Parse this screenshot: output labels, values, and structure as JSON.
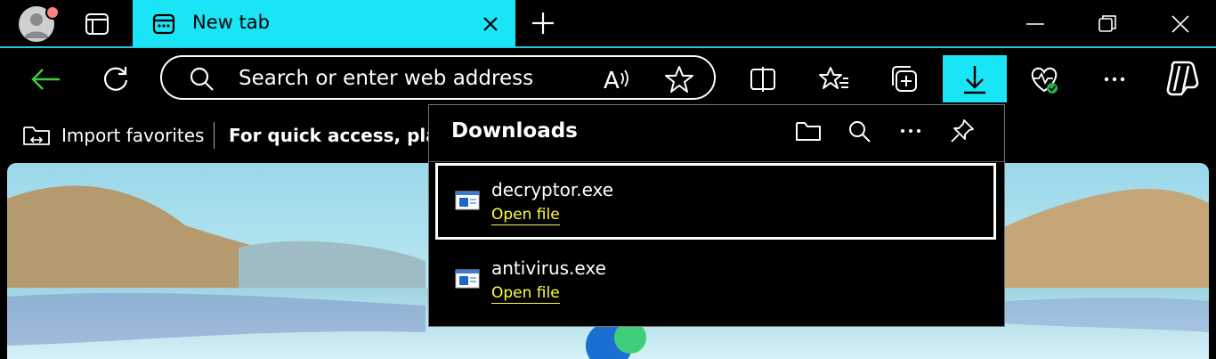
{
  "titlebar": {
    "tab_title": "New tab",
    "profile_icon": "profile-avatar-icon",
    "tab_actions_icon": "tab-actions-icon",
    "new_tab_icon": "plus-icon",
    "window_controls": [
      "minimize-icon",
      "restore-icon",
      "close-icon"
    ]
  },
  "toolbar": {
    "address_placeholder": "Search or enter web address",
    "icons": [
      "back-arrow-icon",
      "refresh-icon",
      "search-icon",
      "read-aloud-icon",
      "favorite-star-icon",
      "split-screen-icon",
      "favorites-icon",
      "collections-icon",
      "downloads-icon",
      "browser-essentials-icon",
      "more-icon",
      "copilot-icon"
    ]
  },
  "favorites_bar": {
    "import_label": "Import favorites",
    "hint_text": "For quick access, place"
  },
  "downloads": {
    "title": "Downloads",
    "header_icons": [
      "open-folder-icon",
      "search-downloads-icon",
      "more-options-icon",
      "pin-icon"
    ],
    "items": [
      {
        "file_name": "decryptor.exe",
        "action": "Open file",
        "selected": true
      },
      {
        "file_name": "antivirus.exe",
        "action": "Open file",
        "selected": false
      }
    ]
  },
  "colors": {
    "accent": "#19e5f7",
    "link": "#ffff3c",
    "back_arrow": "#3ccf3c"
  }
}
